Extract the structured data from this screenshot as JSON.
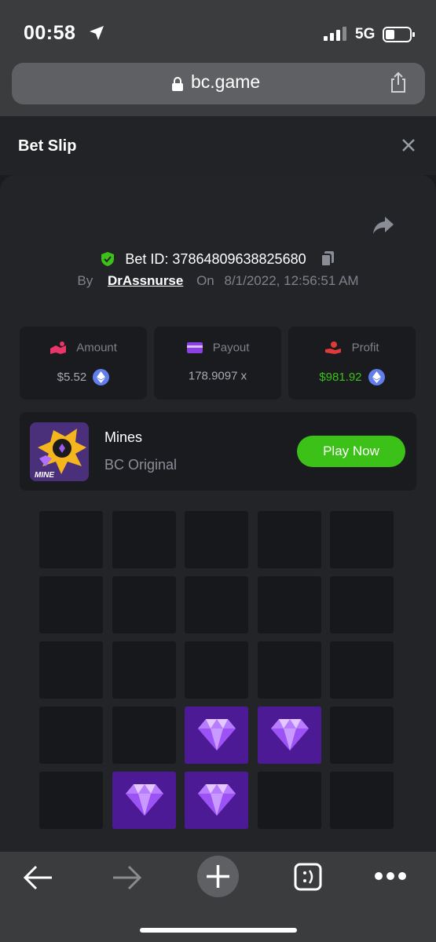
{
  "status_bar": {
    "time": "00:58",
    "network": "5G"
  },
  "browser": {
    "url": "bc.game"
  },
  "bet_slip": {
    "title": "Bet Slip",
    "bet_id_label": "Bet ID:",
    "bet_id": "37864809638825680",
    "by_label": "By",
    "username": "DrAssnurse",
    "on_label": "On",
    "datetime": "8/1/2022, 12:56:51 AM"
  },
  "stats": {
    "amount": {
      "label": "Amount",
      "value": "$5.52"
    },
    "payout": {
      "label": "Payout",
      "value": "178.9097 x"
    },
    "profit": {
      "label": "Profit",
      "value": "$981.92"
    }
  },
  "game": {
    "name": "Mines",
    "provider": "BC Original",
    "thumb_label": "MINE",
    "play_label": "Play Now"
  },
  "mines_grid": {
    "rows": 5,
    "cols": 5,
    "cells": [
      [
        "empty",
        "empty",
        "empty",
        "empty",
        "empty"
      ],
      [
        "empty",
        "empty",
        "empty",
        "empty",
        "empty"
      ],
      [
        "empty",
        "empty",
        "empty",
        "empty",
        "empty"
      ],
      [
        "empty",
        "empty",
        "gem",
        "gem",
        "empty"
      ],
      [
        "empty",
        "gem",
        "gem",
        "empty",
        "empty"
      ]
    ]
  },
  "colors": {
    "accent_green": "#3bc117",
    "gem_tile": "#4b1a94",
    "tile": "#17181b",
    "eth": "#627eea"
  },
  "icons": {
    "status": [
      "location-arrow-icon",
      "signal-icon",
      "battery-icon"
    ],
    "browser": [
      "lock-icon",
      "share-icon"
    ],
    "toolbar": [
      "back-arrow-icon",
      "forward-arrow-icon",
      "new-tab-icon",
      "tabs-icon",
      "more-icon"
    ]
  }
}
